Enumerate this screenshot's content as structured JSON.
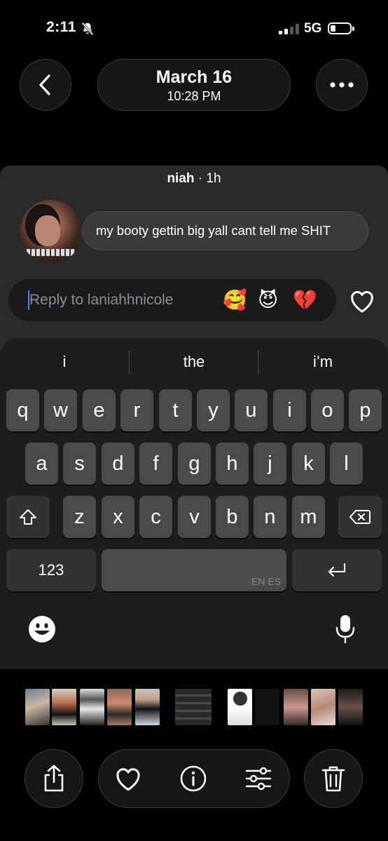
{
  "status_bar": {
    "time": "2:11",
    "network": "5G",
    "icons": [
      "bell-slash-icon",
      "signal-icon",
      "battery-icon"
    ]
  },
  "header": {
    "date": "March 16",
    "time": "10:28 PM",
    "back_icon": "chevron-left-icon",
    "more_icon": "ellipsis-icon"
  },
  "story": {
    "sender": "niah",
    "age": "· 1h",
    "message": "my booty gettin big yall cant tell me SHIT"
  },
  "reply": {
    "placeholder": "Reply to laniahhnicole",
    "quick_reactions": [
      "🥰",
      "😈",
      "💔"
    ],
    "like_icon": "heart-outline-icon"
  },
  "keyboard": {
    "suggestions": [
      "i",
      "the",
      "i’m"
    ],
    "row1": [
      "q",
      "w",
      "e",
      "r",
      "t",
      "y",
      "u",
      "i",
      "o",
      "p"
    ],
    "row2": [
      "a",
      "s",
      "d",
      "f",
      "g",
      "h",
      "j",
      "k",
      "l"
    ],
    "row3": [
      "z",
      "x",
      "c",
      "v",
      "b",
      "n",
      "m"
    ],
    "numbers_label": "123",
    "space_lang": "EN ES",
    "icons": [
      "shift-icon",
      "backspace-icon",
      "return-icon",
      "emoji-icon",
      "microphone-icon"
    ]
  },
  "toolbar": {
    "icons": [
      "share-icon",
      "heart-outline-icon",
      "info-icon",
      "sliders-icon",
      "trash-icon"
    ]
  }
}
